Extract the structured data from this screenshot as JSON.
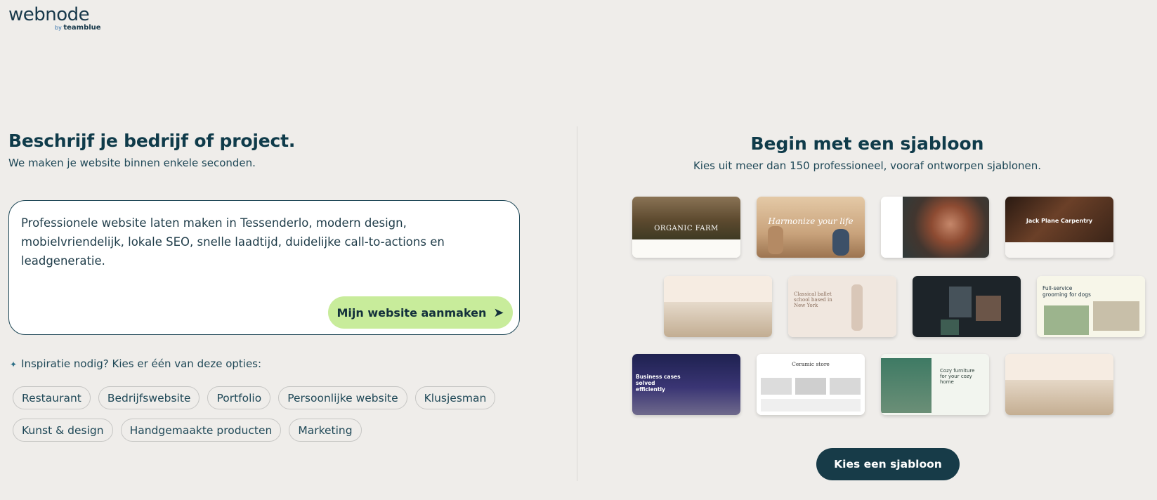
{
  "brand": {
    "name": "webnode",
    "by": "by",
    "parent": "teamblue"
  },
  "ai_section": {
    "title": "Beschrijf je bedrijf of project.",
    "subtitle": "We maken je website binnen enkele seconden.",
    "prompt_value": "Professionele website laten maken in Tessenderlo, modern design, mobielvriendelijk, lokale SEO, snelle laadtijd, duidelijke call-to-actions en leadgeneratie.",
    "create_button": "Mijn website aanmaken",
    "create_arrow": "➤",
    "inspiration_label": "Inspiratie nodig? Kies er één van deze opties:",
    "chips_row1": [
      "Restaurant",
      "Bedrijfswebsite",
      "Portfolio",
      "Persoonlijke website",
      "Klusjesman"
    ],
    "chips_row2": [
      "Kunst & design",
      "Handgemaakte producten",
      "Marketing"
    ]
  },
  "template_section": {
    "title": "Begin met een sjabloon",
    "subtitle": "Kies uit meer dan 150 professioneel, vooraf ontworpen sjablonen.",
    "button": "Kies een sjabloon",
    "thumbnails": {
      "t1": "ORGANIC FARM",
      "t2": "Harmonize your life",
      "t4": "Jack Plane Carpentry",
      "t6": "Classical ballet school based in New York",
      "t8": "Full-service grooming for dogs",
      "t9": "Business cases solved efficiently",
      "t10": "Ceramic store",
      "t11": "Cozy furniture for your cozy home"
    }
  },
  "colors": {
    "background": "#efedea",
    "primary_text": "#0f3b4a",
    "cta_green": "#c8ec9b",
    "cta_dark": "#173b48"
  }
}
